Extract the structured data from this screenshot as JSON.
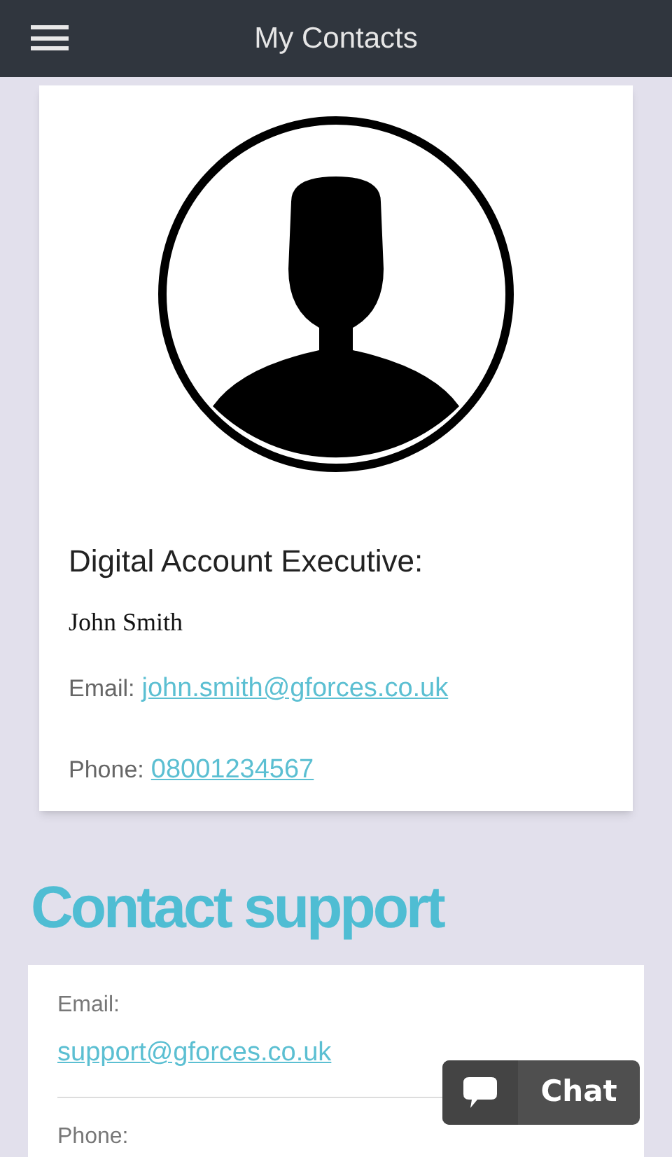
{
  "header": {
    "title": "My Contacts"
  },
  "contact": {
    "role": "Digital Account Executive:",
    "name": "John Smith",
    "fields": [
      {
        "label": "Email:",
        "value": "john.smith@gforces.co.uk"
      },
      {
        "label": "Phone:",
        "value": "08001234567"
      }
    ]
  },
  "support": {
    "heading": "Contact support",
    "items": [
      {
        "label": "Email:",
        "value": "support@gforces.co.uk"
      },
      {
        "label": "Phone:"
      }
    ]
  },
  "chat": {
    "label": "Chat"
  }
}
